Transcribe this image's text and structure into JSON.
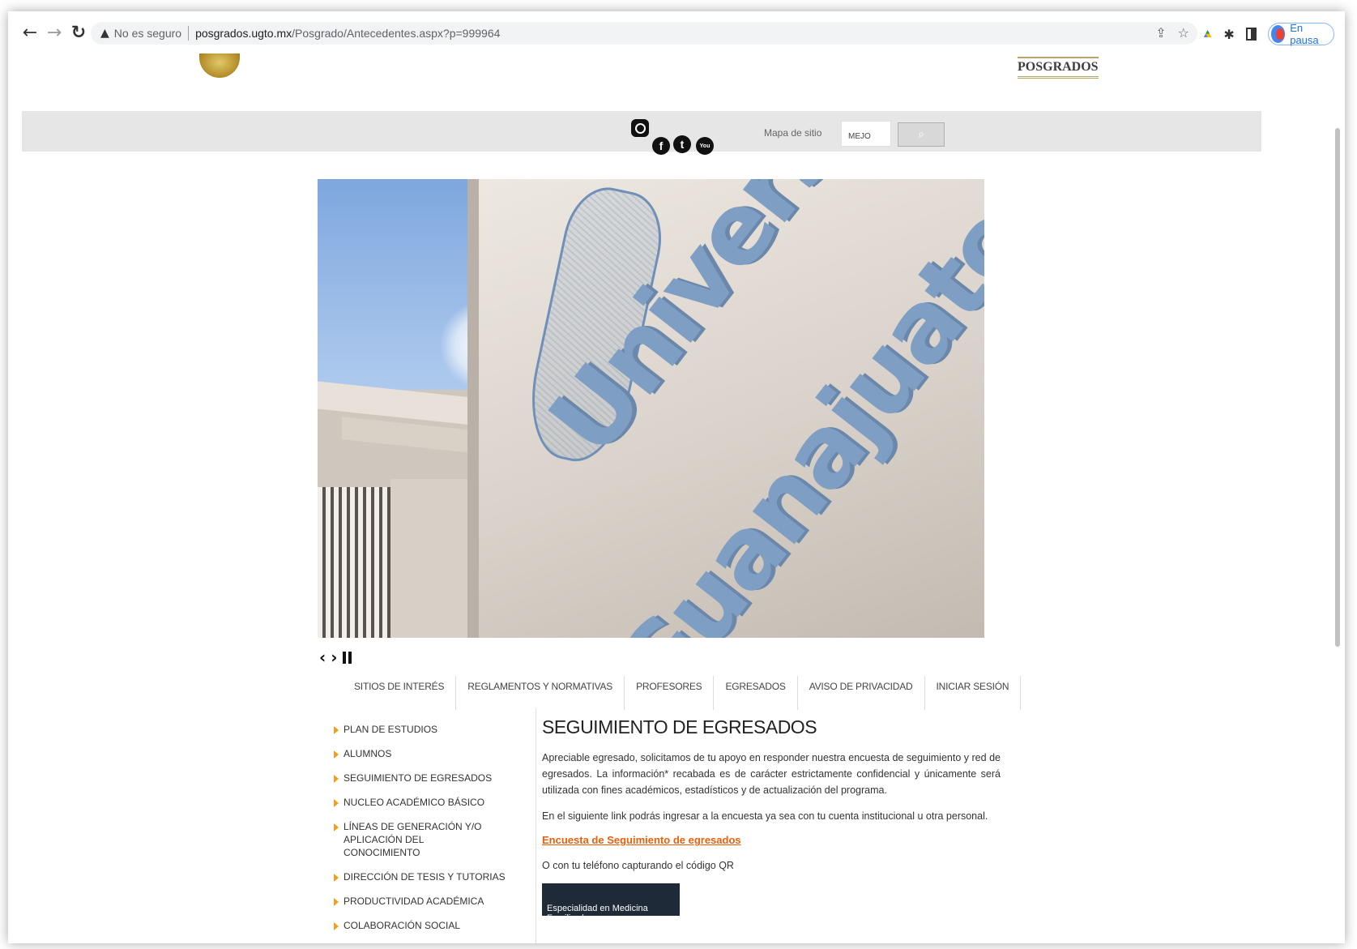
{
  "browser": {
    "not_secure": "No es seguro",
    "url_host": "posgrados.ugto.mx",
    "url_path": "/Posgrado/Antecedentes.aspx?p=999964",
    "profile_label": "En pausa"
  },
  "header": {
    "posgrados_logo": "POSGRADOS",
    "site_map": "Mapa de sitio",
    "search_value": "MEJO"
  },
  "social": {
    "instagram": "instagram-icon",
    "facebook": "f",
    "twitter": "t",
    "youtube": "You"
  },
  "hero": {
    "sign_text_1": "Universidad",
    "sign_text_2": "Guanajuato"
  },
  "tabs": [
    {
      "label": "SITIOS DE INTERÉS"
    },
    {
      "label": "REGLAMENTOS Y NORMATIVAS"
    },
    {
      "label": "PROFESORES"
    },
    {
      "label": "EGRESADOS"
    },
    {
      "label": "AVISO DE PRIVACIDAD"
    },
    {
      "label": "INICIAR SESIÓN"
    }
  ],
  "sidemenu": [
    {
      "label": "PLAN DE ESTUDIOS"
    },
    {
      "label": "ALUMNOS"
    },
    {
      "label": "SEGUIMIENTO DE EGRESADOS"
    },
    {
      "label": "NUCLEO ACADÉMICO BÁSICO"
    },
    {
      "label": "LÍNEAS DE GENERACIÓN Y/O APLICACIÓN DEL CONOCIMIENTO"
    },
    {
      "label": "DIRECCIÓN DE TESIS Y TUTORIAS"
    },
    {
      "label": "PRODUCTIVIDAD ACADÉMICA"
    },
    {
      "label": "COLABORACIÓN SOCIAL"
    }
  ],
  "content": {
    "title": "SEGUIMIENTO DE EGRESADOS",
    "para1": "Apreciable egresado, solicitamos de tu apoyo en responder nuestra encuesta de seguimiento y red de egresados. La información* recabada es de carácter estrictamente confidencial y únicamente será utilizada con fines académicos, estadísticos y de actualización del programa.",
    "para2": "En el siguiente link podrás ingresar a la encuesta ya sea con tu cuenta institucional u otra personal.",
    "survey_link": "Encuesta de Seguimiento de egresados",
    "para3": "O con tu teléfono capturando el código QR",
    "qr_banner": "Especialidad en Medicina Familiar /"
  },
  "colors": {
    "accent_orange": "#e8600a",
    "menu_bullet": "#f0a020",
    "gray_bar": "#e6e6e6",
    "banner_dark": "#1f2a38"
  }
}
